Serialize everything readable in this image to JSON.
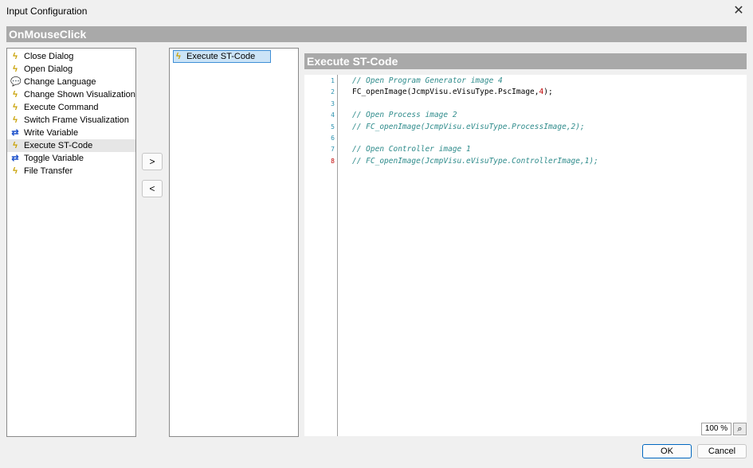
{
  "window": {
    "title": "Input Configuration",
    "close_glyph": "✕"
  },
  "event": {
    "name": "OnMouseClick"
  },
  "actions": [
    {
      "label": "Close Dialog",
      "icon": "lightning-icon"
    },
    {
      "label": "Open Dialog",
      "icon": "lightning-icon"
    },
    {
      "label": "Change Language",
      "icon": "speech-bubble-icon"
    },
    {
      "label": "Change Shown Visualization",
      "icon": "lightning-icon"
    },
    {
      "label": "Execute Command",
      "icon": "lightning-icon"
    },
    {
      "label": "Switch Frame Visualization",
      "icon": "lightning-icon"
    },
    {
      "label": "Write Variable",
      "icon": "variable-icon"
    },
    {
      "label": "Execute ST-Code",
      "icon": "lightning-icon",
      "selected": true
    },
    {
      "label": "Toggle Variable",
      "icon": "variable-icon"
    },
    {
      "label": "File Transfer",
      "icon": "lightning-icon"
    }
  ],
  "buttons": {
    "add": ">",
    "remove": "<",
    "ok": "OK",
    "cancel": "Cancel"
  },
  "selected_actions": [
    {
      "label": "Execute ST-Code",
      "icon": "lightning-icon"
    }
  ],
  "code_panel": {
    "header": "Execute ST-Code",
    "lines": [
      {
        "number": "1",
        "text": "// Open Program Generator image 4",
        "type": "comment"
      },
      {
        "number": "2",
        "pre": "FC_openImage(JcmpVisu.eVisuType.PscImage,",
        "num": "4",
        "post": ");",
        "type": "code"
      },
      {
        "number": "3",
        "text": "",
        "type": "blank"
      },
      {
        "number": "4",
        "text": "// Open Process image 2",
        "type": "comment"
      },
      {
        "number": "5",
        "text": "// FC_openImage(JcmpVisu.eVisuType.ProcessImage,2);",
        "type": "comment"
      },
      {
        "number": "6",
        "text": "",
        "type": "blank"
      },
      {
        "number": "7",
        "text": "// Open Controller image 1",
        "type": "comment"
      },
      {
        "number": "8",
        "text": "// FC_openImage(JcmpVisu.eVisuType.ControllerImage,1);",
        "type": "comment",
        "error": true
      }
    ],
    "zoom": "100 %"
  },
  "colors": {
    "header_bg": "#a9a9a9",
    "selection": "#cce4f7",
    "comment": "#2e8b8b",
    "line_number": "#2b91af"
  }
}
